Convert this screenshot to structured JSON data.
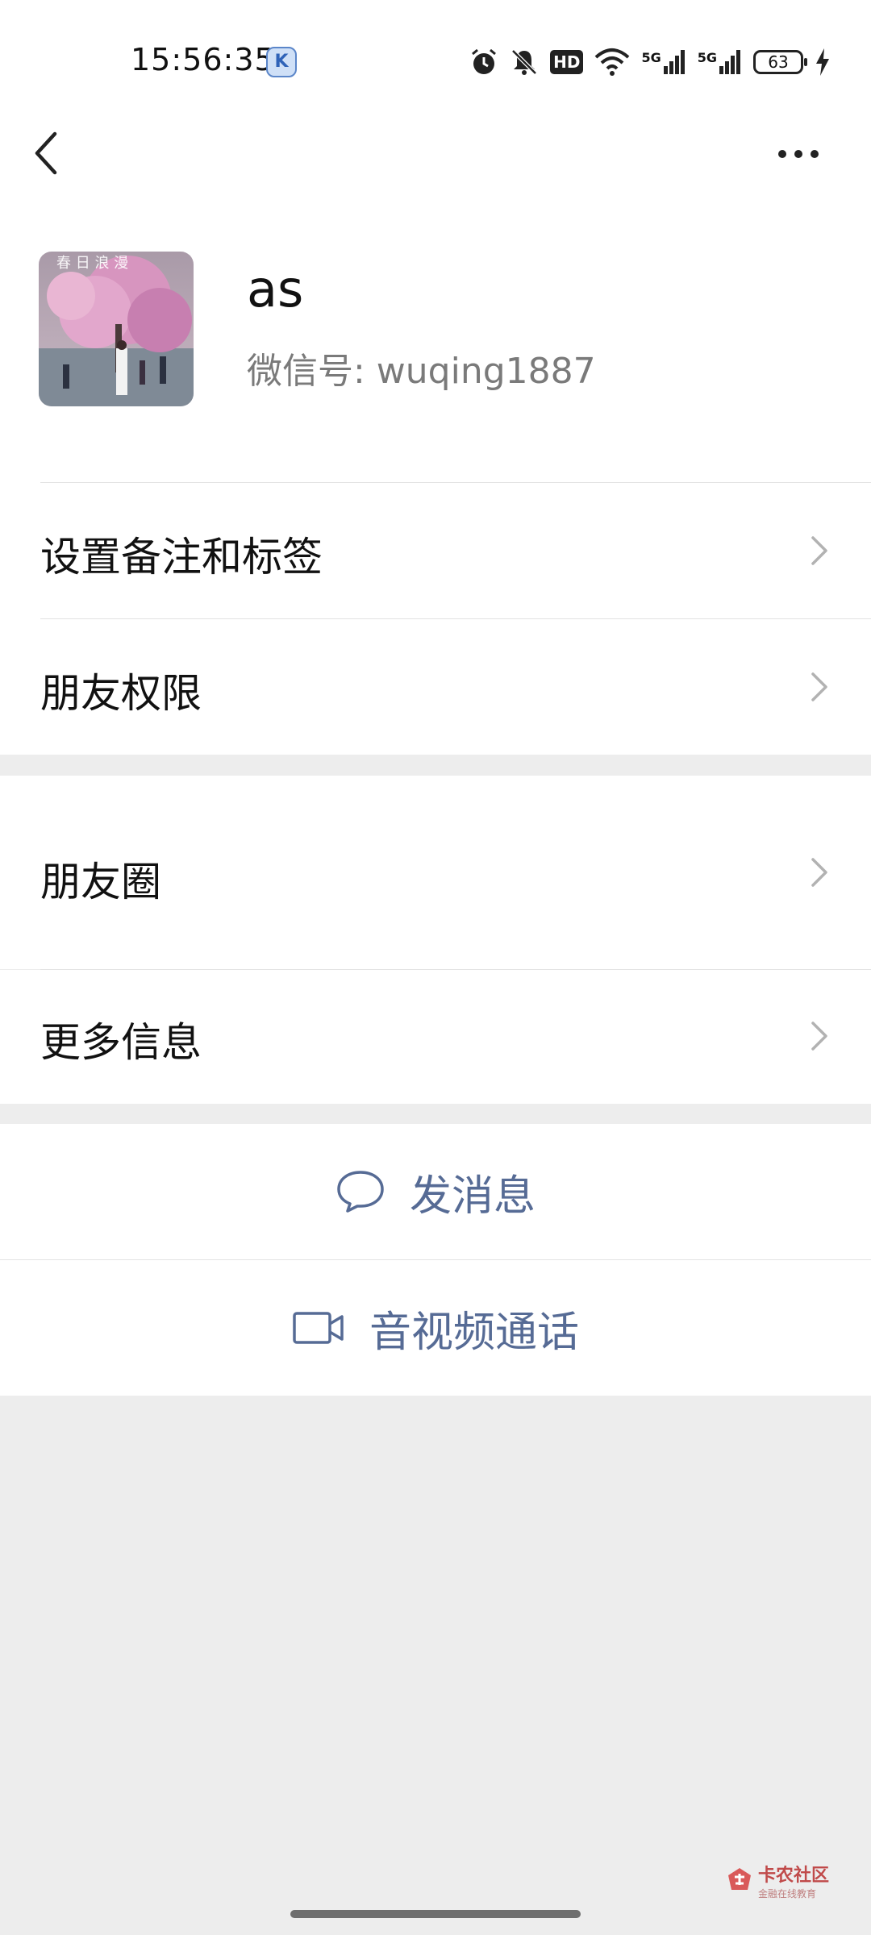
{
  "status_bar": {
    "time": "15:56:35",
    "app_badge": "K",
    "hd_label": "HD",
    "network_1": "5G",
    "network_2": "5G",
    "battery": "63",
    "icons": [
      "alarm-icon",
      "mute-bell-icon",
      "hd-icon",
      "wifi-icon",
      "signal-5g-icon",
      "signal-5g-icon",
      "battery-icon",
      "charging-icon"
    ]
  },
  "nav": {
    "back_icon": "back-chevron-icon",
    "more_icon": "more-dots-icon"
  },
  "profile": {
    "name": "as",
    "wechat_id_label": "微信号: wuqing1887"
  },
  "menu": {
    "remarks_tags": "设置备注和标签",
    "friend_permissions": "朋友权限",
    "moments": "朋友圈",
    "more_info": "更多信息"
  },
  "actions": {
    "send_message": "发消息",
    "av_call": "音视频通话"
  },
  "watermark": {
    "title": "卡农社区",
    "subtitle": "金融在线教育"
  },
  "colors": {
    "background": "#ededed",
    "surface": "#ffffff",
    "action_text": "#566b95",
    "secondary_text": "#7a7a7a"
  }
}
